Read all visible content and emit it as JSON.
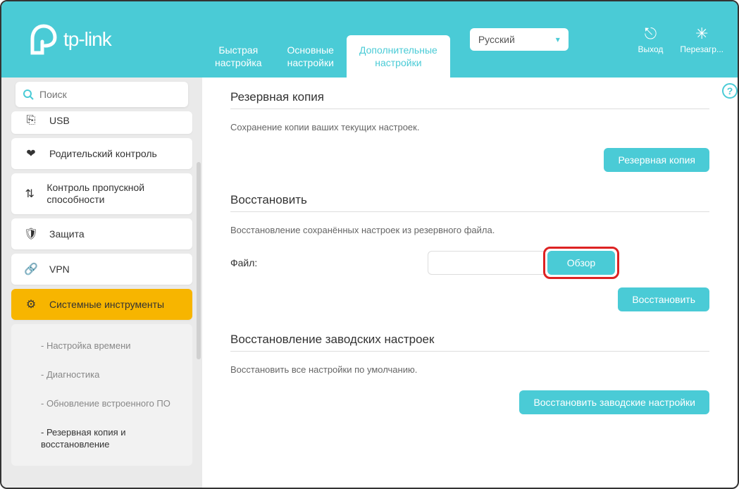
{
  "brand": "tp-link",
  "search": {
    "placeholder": "Поиск"
  },
  "headerTabs": {
    "quick": {
      "l1": "Быстрая",
      "l2": "настройка"
    },
    "basic": {
      "l1": "Основные",
      "l2": "настройки"
    },
    "advanced": {
      "l1": "Дополнительные",
      "l2": "настройки"
    }
  },
  "language": {
    "selected": "Русский"
  },
  "actions": {
    "logout": "Выход",
    "reboot": "Перезагр..."
  },
  "sidebar": {
    "items": [
      {
        "label": "USB"
      },
      {
        "label": "Родительский контроль"
      },
      {
        "label": "Контроль пропускной способности"
      },
      {
        "label": "Защита"
      },
      {
        "label": "VPN"
      },
      {
        "label": "Системные инструменты"
      }
    ],
    "sub": [
      {
        "label": "- Настройка времени"
      },
      {
        "label": "- Диагностика"
      },
      {
        "label": "- Обновление встроенного ПО"
      },
      {
        "label": "- Резервная копия и восстановление"
      }
    ]
  },
  "content": {
    "backup": {
      "title": "Резервная копия",
      "desc": "Сохранение копии ваших текущих настроек.",
      "btn": "Резервная копия"
    },
    "restore": {
      "title": "Восстановить",
      "desc": "Восстановление сохранённых настроек из резервного файла.",
      "fileLabel": "Файл:",
      "browse": "Обзор",
      "btn": "Восстановить"
    },
    "factory": {
      "title": "Восстановление заводских настроек",
      "desc": "Восстановить все настройки по умолчанию.",
      "btn": "Восстановить заводские настройки"
    }
  }
}
